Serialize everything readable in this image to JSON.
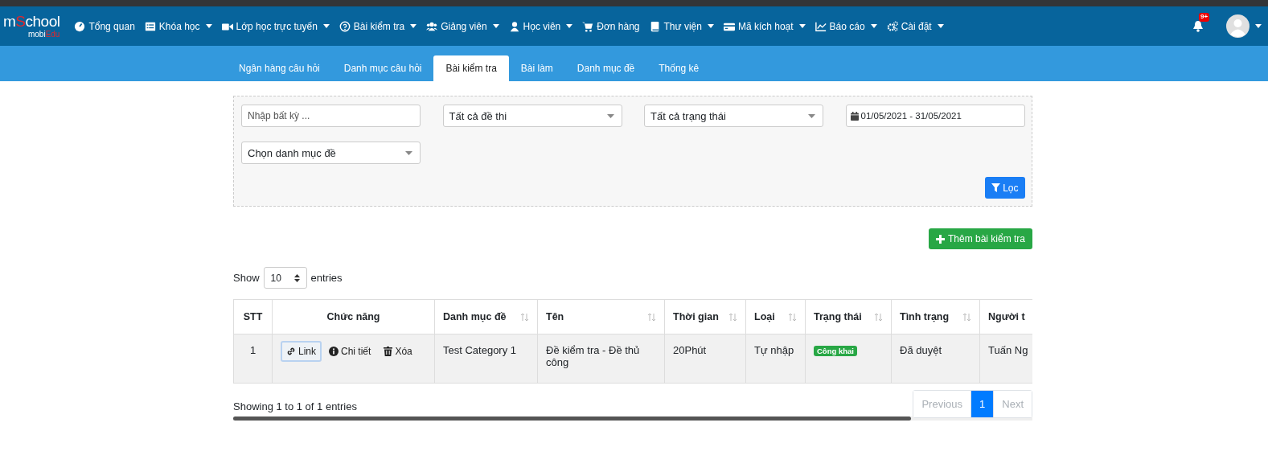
{
  "logo": {
    "top": [
      {
        "text": "m",
        "accent": false
      },
      {
        "text": "S",
        "accent": true
      },
      {
        "text": "chool",
        "accent": false
      }
    ],
    "bottom": [
      {
        "text": "mobi",
        "accent": false
      },
      {
        "text": "Edu",
        "accent": true
      }
    ]
  },
  "nav": [
    {
      "label": "Tổng quan",
      "dropdown": false
    },
    {
      "label": "Khóa học",
      "dropdown": true
    },
    {
      "label": "Lớp học trực tuyến",
      "dropdown": true
    },
    {
      "label": "Bài kiểm tra",
      "dropdown": true
    },
    {
      "label": "Giảng viên",
      "dropdown": true
    },
    {
      "label": "Học viên",
      "dropdown": true
    },
    {
      "label": "Đơn hàng",
      "dropdown": false
    },
    {
      "label": "Thư viện",
      "dropdown": true
    },
    {
      "label": "Mã kích hoạt",
      "dropdown": true
    },
    {
      "label": "Báo cáo",
      "dropdown": true
    },
    {
      "label": "Cài đặt",
      "dropdown": true
    }
  ],
  "notifications": {
    "badge": "9+"
  },
  "tabs": [
    {
      "label": "Ngân hàng câu hỏi",
      "selected": false
    },
    {
      "label": "Danh mục câu hỏi",
      "selected": false
    },
    {
      "label": "Bài kiểm tra",
      "selected": true
    },
    {
      "label": "Bài làm",
      "selected": false
    },
    {
      "label": "Danh mục đề",
      "selected": false
    },
    {
      "label": "Thống kê",
      "selected": false
    }
  ],
  "filters": [
    {
      "kind": "text",
      "placeholder": "Nhập bất kỳ ..."
    },
    {
      "kind": "select",
      "value": "Tất cả đề thi"
    },
    {
      "kind": "select",
      "value": "Tất cả trạng thái"
    },
    {
      "kind": "date",
      "value": "01/05/2021 - 31/05/2021"
    },
    {
      "kind": "select",
      "value": "Chọn danh mục đề"
    }
  ],
  "filter_button": "Lọc",
  "add_button": "Thêm bài kiểm tra",
  "length": {
    "prefix": "Show",
    "value": "10",
    "suffix": "entries"
  },
  "table": {
    "columns": [
      {
        "label": "STT",
        "sortable": false
      },
      {
        "label": "Chức năng",
        "sortable": false
      },
      {
        "label": "Danh mục đề",
        "sortable": true
      },
      {
        "label": "Tên",
        "sortable": true
      },
      {
        "label": "Thời gian",
        "sortable": true
      },
      {
        "label": "Loại",
        "sortable": true
      },
      {
        "label": "Trạng thái",
        "sortable": true
      },
      {
        "label": "Tình trạng",
        "sortable": true
      },
      {
        "label": "Người t"
      }
    ],
    "rows": [
      {
        "stt": "1",
        "actions": [
          {
            "kind": "link",
            "label": "Link",
            "focused": true
          },
          {
            "kind": "info",
            "label": "Chi tiết",
            "focused": false
          },
          {
            "kind": "delete",
            "label": "Xóa",
            "focused": false
          }
        ],
        "category": "Test Category 1",
        "name": "Đề kiểm tra - Đề thủ công",
        "duration": "20Phút",
        "type": "Tự nhập",
        "status": "Công khai",
        "approval": "Đã duyệt",
        "creator": "Tuấn Ng"
      }
    ]
  },
  "info": "Showing 1 to 1 of 1 entries",
  "pagination": [
    {
      "label": "Previous",
      "selected": false,
      "disabled": true
    },
    {
      "label": "1",
      "selected": true,
      "disabled": false
    },
    {
      "label": "Next",
      "selected": false,
      "disabled": true
    }
  ]
}
